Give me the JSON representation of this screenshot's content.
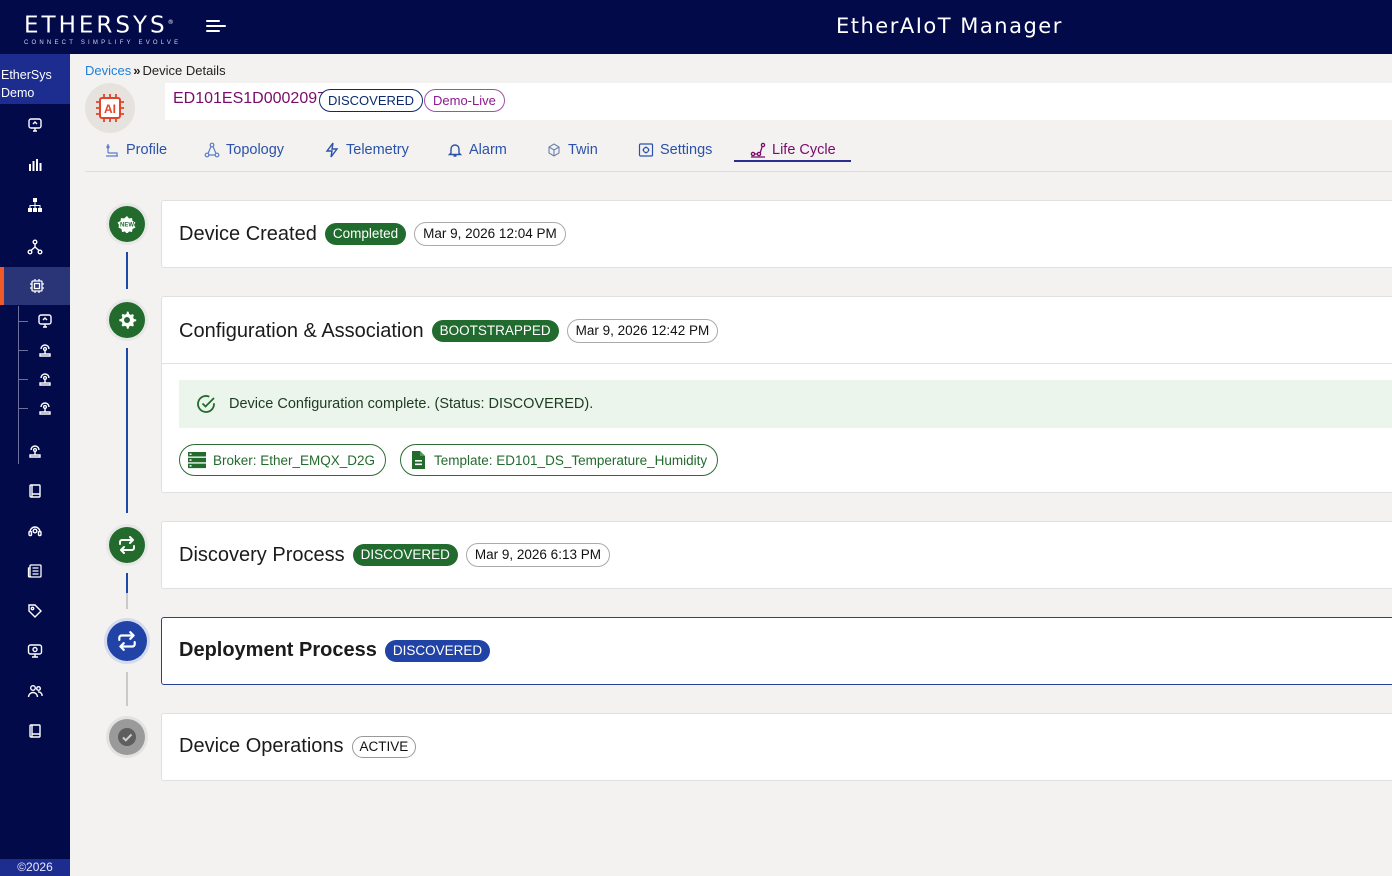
{
  "brand": {
    "logo_text": "ETHERSYS",
    "tagline": "CONNECT SIMPLIFY EVOLVE",
    "registered": "®"
  },
  "app_title": "EtherAIoT Manager",
  "sidebar": {
    "org_line1": "EtherSys",
    "org_line2": "Demo",
    "copyright": "©2026"
  },
  "breadcrumb": {
    "link": "Devices",
    "separator": "»",
    "current": "Device Details"
  },
  "device": {
    "id": "ED101ES1D0002097",
    "status": "DISCOVERED",
    "environment": "Demo-Live",
    "avatar_label": "AI"
  },
  "tabs": [
    {
      "label": "Profile",
      "icon": "profile-icon"
    },
    {
      "label": "Topology",
      "icon": "topology-icon"
    },
    {
      "label": "Telemetry",
      "icon": "lightning-icon"
    },
    {
      "label": "Alarm",
      "icon": "bell-icon"
    },
    {
      "label": "Twin",
      "icon": "cube-icon"
    },
    {
      "label": "Settings",
      "icon": "settings-icon"
    },
    {
      "label": "Life Cycle",
      "icon": "lifecycle-icon",
      "active": true
    }
  ],
  "lifecycle": {
    "created": {
      "title": "Device Created",
      "badge": "Completed",
      "time": "Mar 9, 2026 12:04 PM",
      "node_label": "NEW"
    },
    "configuration": {
      "title": "Configuration & Association",
      "badge": "BOOTSTRAPPED",
      "time": "Mar 9, 2026 12:42 PM",
      "message": "Device Configuration complete. (Status: DISCOVERED).",
      "broker": "Broker: Ether_EMQX_D2G",
      "template": "Template: ED101_DS_Temperature_Humidity"
    },
    "discovery": {
      "title": "Discovery Process",
      "badge": "DISCOVERED",
      "time": "Mar 9, 2026 6:13 PM"
    },
    "deployment": {
      "title": "Deployment Process",
      "badge": "DISCOVERED"
    },
    "operations": {
      "title": "Device Operations",
      "badge": "ACTIVE"
    }
  },
  "colors": {
    "navy": "#020a4a",
    "accent_orange": "#f05a28",
    "success_green": "#216b2f",
    "primary_blue": "#2143a6",
    "device_id_purple": "#7a0b6b"
  }
}
